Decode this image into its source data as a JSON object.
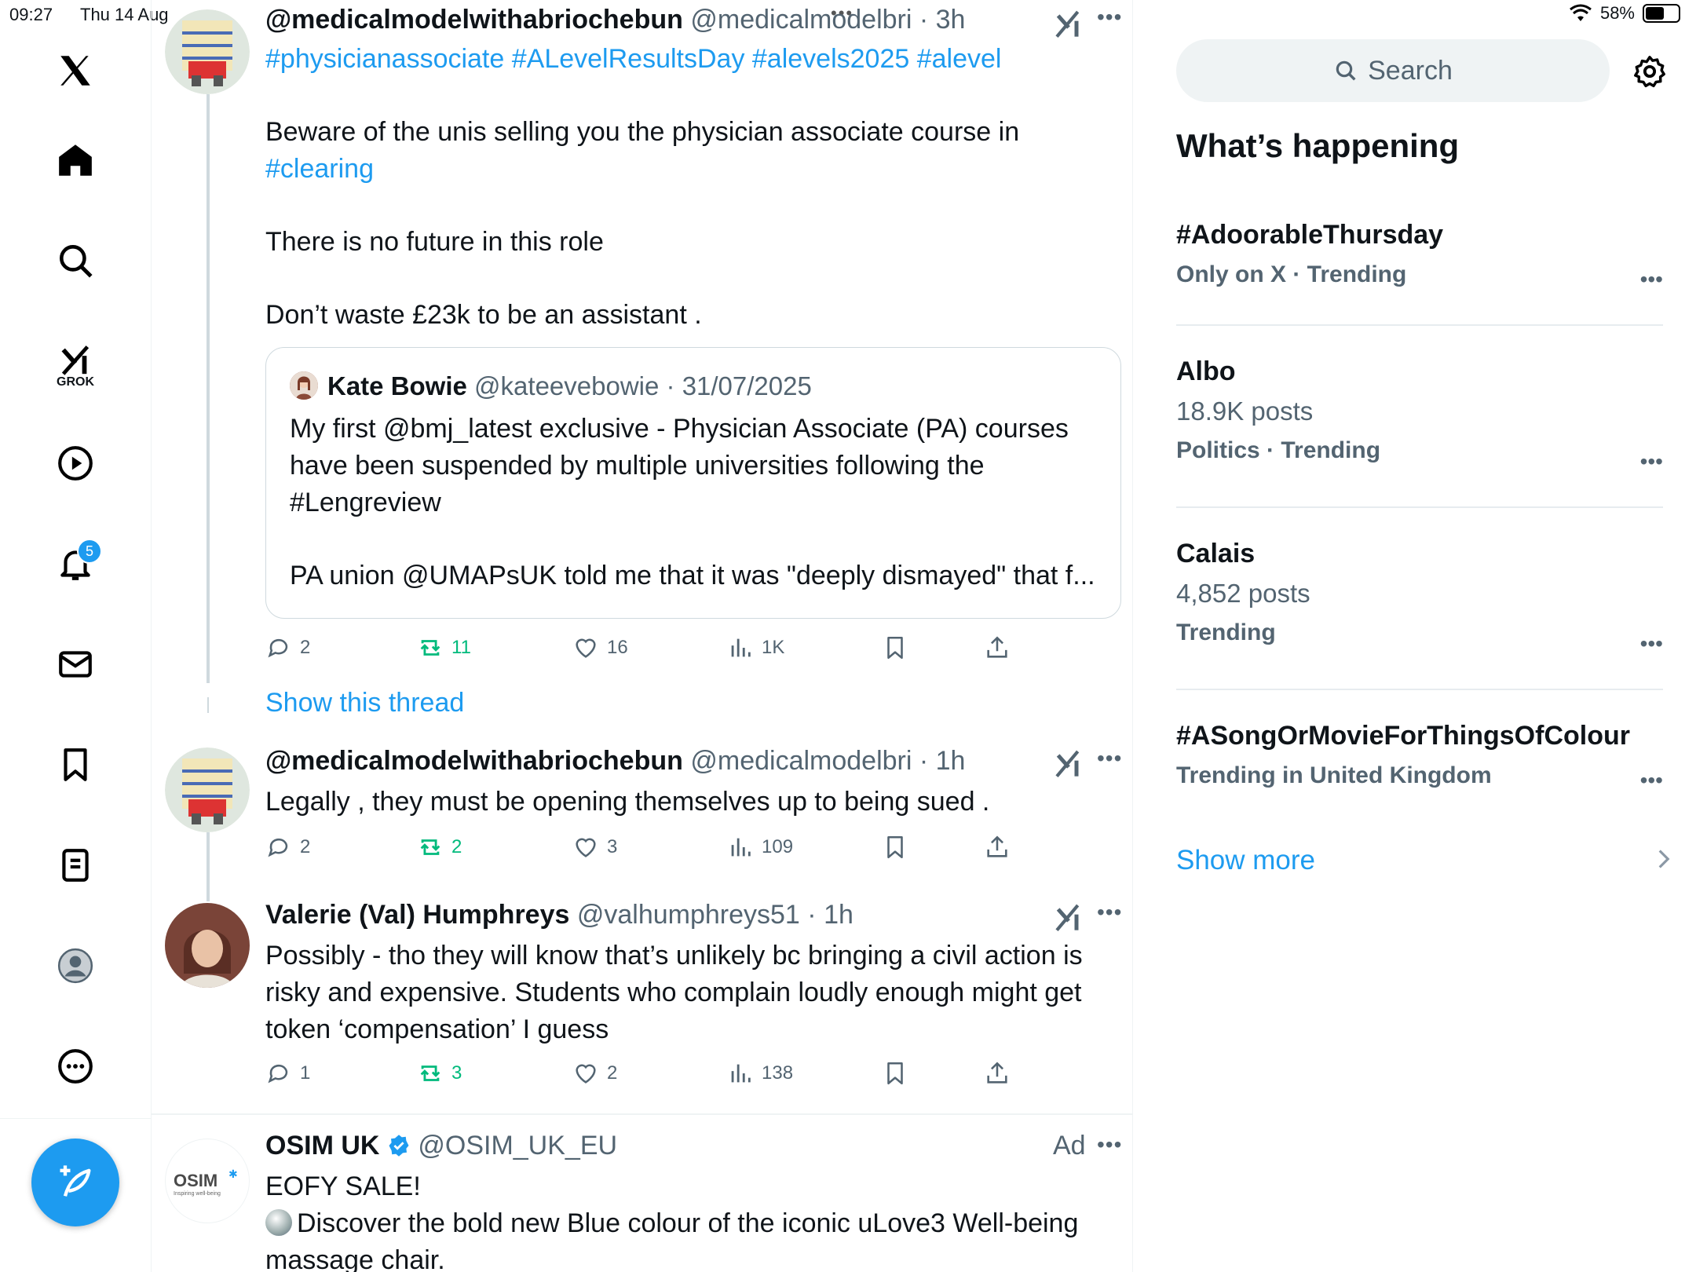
{
  "status_bar": {
    "time": "09:27",
    "date": "Thu 14 Aug",
    "battery": "58%",
    "battery_level": 0.58
  },
  "nav": {
    "grok_label": "GROK",
    "notifications_count": "5"
  },
  "tweets": [
    {
      "name": "@medicalmodelwithabriochebun",
      "handle": "@medicalmodelbri",
      "time": "3h",
      "hashtags": "#physicianassociate #ALevelResultsDay #alevels2025 #alevel",
      "line1": "Beware of the unis selling you the physician associate course in",
      "line1_link": "#clearing",
      "line2": "There is no future in this role",
      "line3": "Don’t waste £23k to be an assistant .",
      "quote": {
        "name": "Kate Bowie",
        "handle": "@kateevebowie",
        "date": "31/07/2025",
        "text1": "My first @bmj_latest exclusive - Physician Associate (PA) courses have been suspended by multiple universities following the #Lengreview",
        "text2": "PA union @UMAPsUK told me that it was \"deeply dismayed\" that f..."
      },
      "replies": "2",
      "reposts": "11",
      "likes": "16",
      "views": "1K"
    },
    {
      "name": "@medicalmodelwithabriochebun",
      "handle": "@medicalmodelbri",
      "time": "1h",
      "text": "Legally , they must be opening themselves up to being sued .",
      "replies": "2",
      "reposts": "2",
      "likes": "3",
      "views": "109"
    },
    {
      "name": "Valerie (Val) Humphreys",
      "handle": "@valhumphreys51",
      "time": "1h",
      "text": "Possibly - tho they will know that’s unlikely bc bringing a civil action is risky and expensive. Students who complain loudly enough might get token ‘compensation’ I guess",
      "replies": "1",
      "reposts": "3",
      "likes": "2",
      "views": "138"
    },
    {
      "name": "OSIM UK",
      "handle": "@OSIM_UK_EU",
      "ad_label": "Ad",
      "line1": "EOFY SALE!",
      "line2": "Discover the bold new Blue colour of the iconic uLove3 Well-being massage chair.",
      "avatar_logo": "OSIM",
      "avatar_tagline": "Inspiring well-being"
    }
  ],
  "show_thread": "Show this thread",
  "sidebar": {
    "search_placeholder": "Search",
    "title": "What’s happening",
    "trends": [
      {
        "name": "#AdoorableThursday",
        "posts": "",
        "meta": "Only on X · Trending"
      },
      {
        "name": "Albo",
        "posts": "18.9K posts",
        "meta": "Politics · Trending"
      },
      {
        "name": "Calais",
        "posts": "4,852 posts",
        "meta": "Trending"
      },
      {
        "name": "#ASongOrMovieForThingsOfColour",
        "posts": "",
        "meta": "Trending in United Kingdom"
      }
    ],
    "show_more": "Show more"
  },
  "colors": {
    "accent": "#1d9bf0",
    "repost": "#00ba7c",
    "muted": "#536471"
  }
}
